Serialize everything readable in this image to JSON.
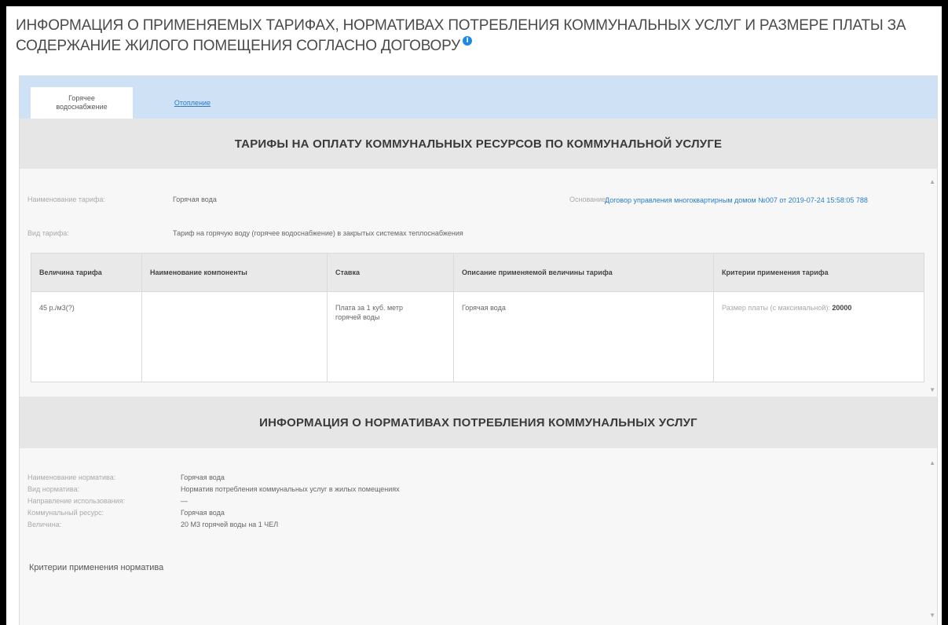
{
  "page": {
    "title": "Информация о применяемых тарифах, нормативах потребления коммунальных услуг и размере платы за содержание жилого помещения согласно договору",
    "info_icon": "info-icon"
  },
  "tabs": [
    {
      "label": "Горячее водоснабжение",
      "active": true
    },
    {
      "label": "Отопление",
      "active": false
    }
  ],
  "tariffs_section": {
    "heading": "Тарифы на оплату коммунальных ресурсов по коммунальной услуге",
    "name_label": "Наименование тарифа:",
    "name_value": "Горячая вода",
    "type_label": "Вид тарифа:",
    "type_value": "Тариф на горячую воду (горячее водоснабжение) в закрытых системах теплоснабжения",
    "basis_label": "Основание:",
    "basis_link": "Договор управления многоквартирным домом №007 от 2019-07-24 15:58:05 788",
    "table": {
      "headers": [
        "Величина тарифа",
        "Наименование компоненты",
        "Ставка",
        "Описание применяемой величины тарифа",
        "Критерии применения тарифа"
      ],
      "rows": [
        {
          "value": "45 р./м3(?)",
          "component": "",
          "rate": "Плата за 1 куб. метр горячей воды",
          "description": "Горячая вода",
          "criteria_label": "Размер платы (с максимальной):",
          "criteria_value": "20000"
        }
      ]
    }
  },
  "norms_section": {
    "heading": "Информация о нормативах потребления коммунальных услуг",
    "fields": [
      {
        "label": "Наименование норматива:",
        "value": "Горячая вода"
      },
      {
        "label": "Вид норматива:",
        "value": "Норматив потребления коммунальных услуг в жилых помещениях"
      },
      {
        "label": "Направление использования:",
        "value": "—"
      },
      {
        "label": "Коммунальный ресурс:",
        "value": "Горячая вода"
      },
      {
        "label": "Величина:",
        "value": "20 М3 горячей воды на 1 ЧЕЛ"
      }
    ],
    "criteria_title": "Критерии применения норматива"
  }
}
